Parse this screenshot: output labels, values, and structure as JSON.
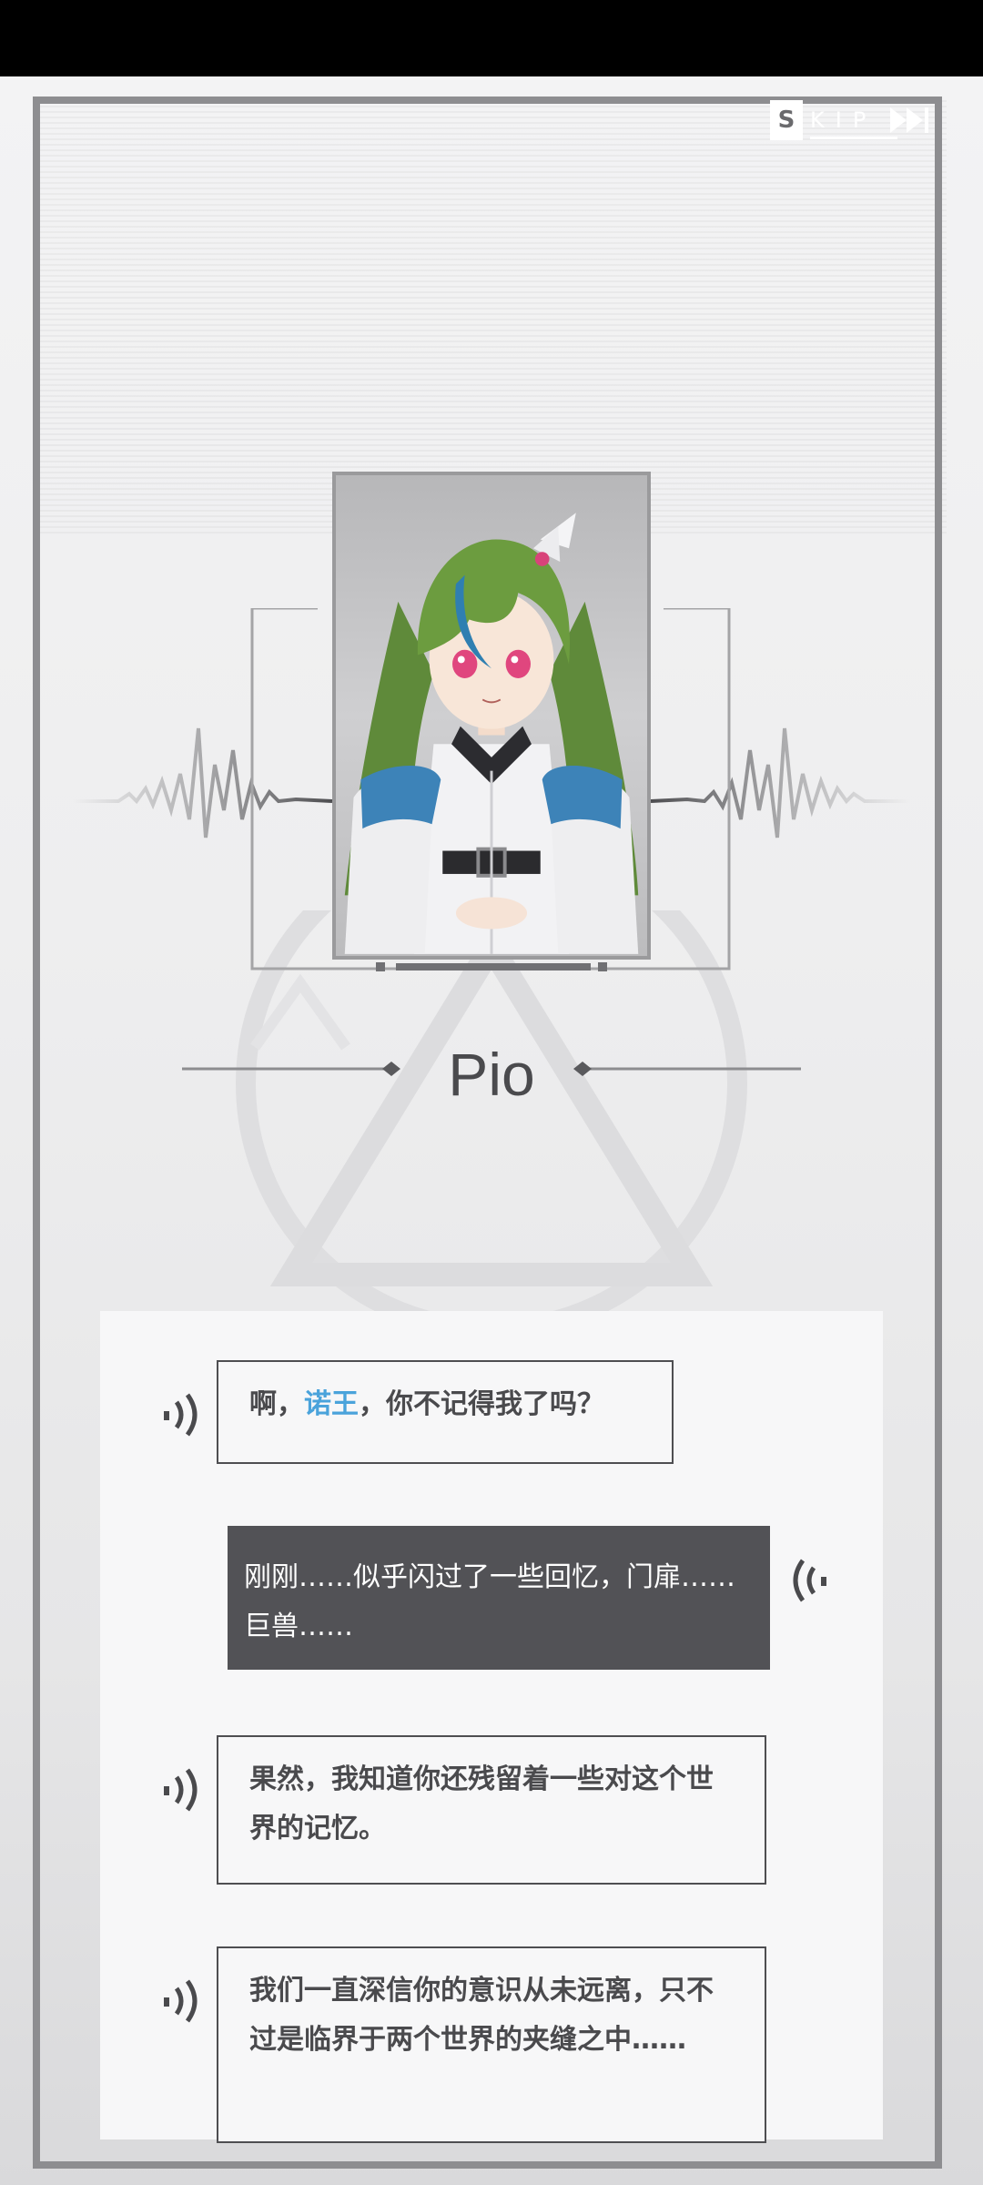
{
  "skip": {
    "label_first": "S",
    "label_rest": "KIP"
  },
  "character": {
    "name": "Pio"
  },
  "dialogue": [
    {
      "speaker": "npc",
      "text_before": "啊，",
      "highlight": "诺王",
      "text_after": "，你不记得我了吗？"
    },
    {
      "speaker": "player",
      "text": "刚刚……似乎闪过了一些回忆，门扉……巨兽……"
    },
    {
      "speaker": "npc",
      "text": "果然，我知道你还残留着一些对这个世界的记忆。"
    },
    {
      "speaker": "npc",
      "text": "我们一直深信你的意识从未远离，只不过是临界于两个世界的夹缝之中……"
    }
  ],
  "colors": {
    "highlight": "#4aa3db",
    "player_bubble": "#525256",
    "frame": "#8d8d90"
  },
  "icons": {
    "voice": "voice-wave-icon",
    "skip": "fast-forward-icon"
  }
}
